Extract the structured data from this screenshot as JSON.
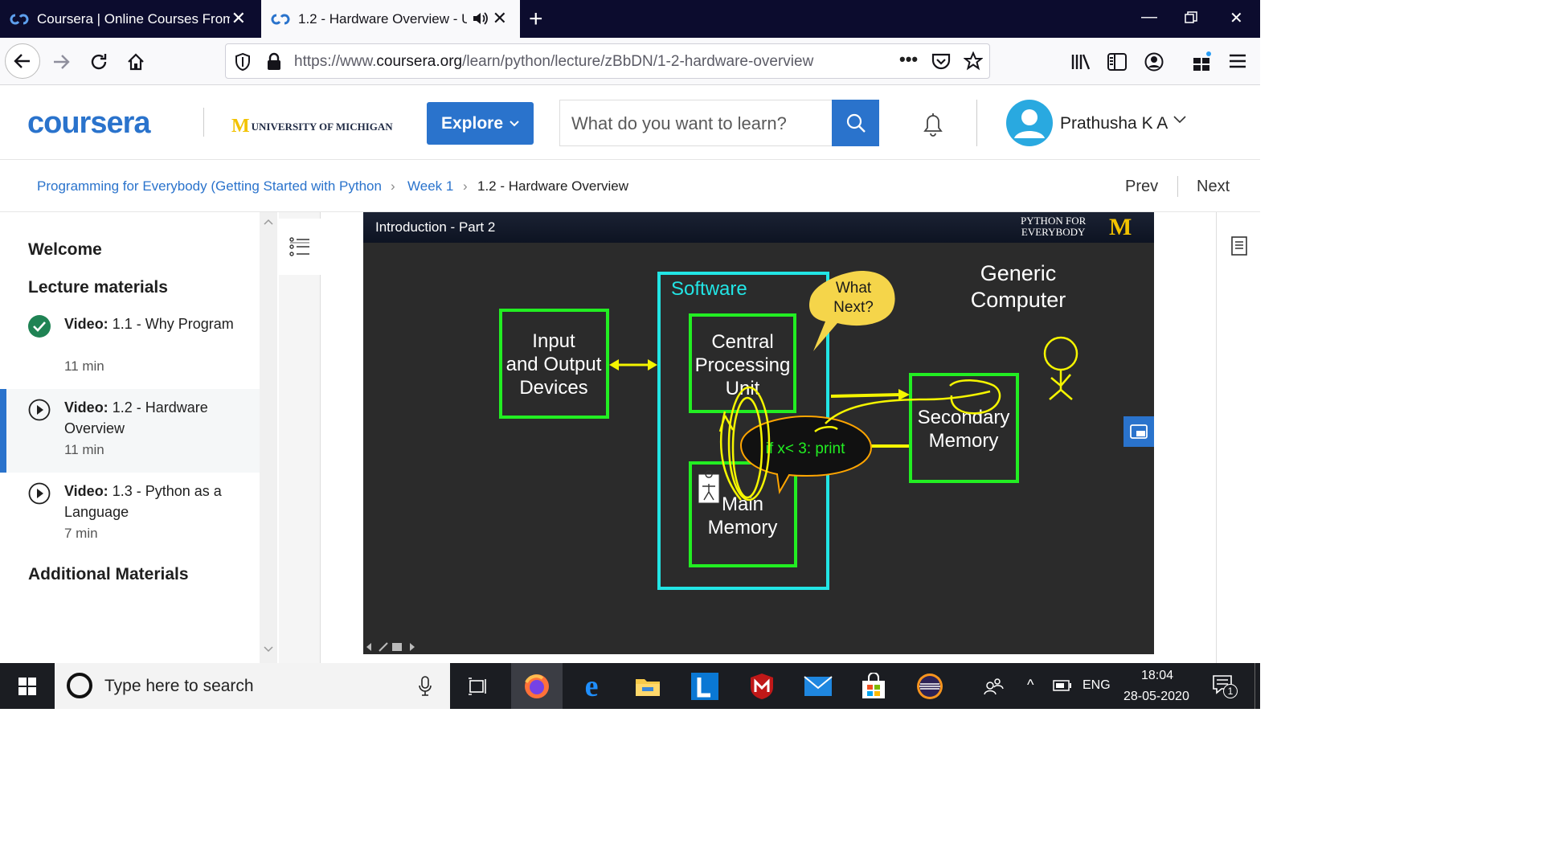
{
  "browser": {
    "tabs": [
      {
        "title": "Coursera | Online Courses From",
        "active": false
      },
      {
        "title": "1.2 - Hardware Overview - U",
        "active": true
      }
    ],
    "url_prefix": "https://www.",
    "url_host": "coursera.org",
    "url_path": "/learn/python/lecture/zBbDN/1-2-hardware-overview"
  },
  "header": {
    "logo": "coursera",
    "partner": "UNIVERSITY OF MICHIGAN",
    "explore_label": "Explore",
    "search_placeholder": "What do you want to learn?",
    "user_name": "Prathusha K A"
  },
  "breadcrumb": {
    "course": "Programming for Everybody (Getting Started with Python",
    "week": "Week 1",
    "current": "1.2 - Hardware Overview",
    "prev": "Prev",
    "next": "Next"
  },
  "sidebar": {
    "welcome": "Welcome",
    "lecture_materials": "Lecture materials",
    "items": [
      {
        "type": "Video:",
        "title": "1.1 - Why Program",
        "duration": "11 min",
        "status": "completed"
      },
      {
        "type": "Video:",
        "title": "1.2 - Hardware Overview",
        "duration": "11 min",
        "status": "current"
      },
      {
        "type": "Video:",
        "title": "1.3 - Python as a Language",
        "duration": "7 min",
        "status": "pending"
      }
    ],
    "additional": "Additional Materials"
  },
  "slide": {
    "title": "Introduction - Part 2",
    "brand_line1": "PYTHON FOR",
    "brand_line2": "EVERYBODY",
    "brand_m": "M",
    "generic1": "Generic",
    "generic2": "Computer",
    "software": "Software",
    "what1": "What",
    "what2": "Next?",
    "io1": "Input",
    "io2": "and Output",
    "io3": "Devices",
    "cpu1": "Central",
    "cpu2": "Processing",
    "cpu3": "Unit",
    "code": "if x< 3: print",
    "mem1": "Main",
    "mem2": "Memory",
    "sec1": "Secondary",
    "sec2": "Memory"
  },
  "taskbar": {
    "search_placeholder": "Type here to search",
    "lang": "ENG",
    "time": "18:04",
    "date": "28-05-2020",
    "notif_count": "1"
  },
  "colors": {
    "accent": "#2a73cc",
    "slide_green": "#22ee22",
    "slide_cyan": "#22e5e5",
    "annotation_yellow": "#f5f500"
  }
}
